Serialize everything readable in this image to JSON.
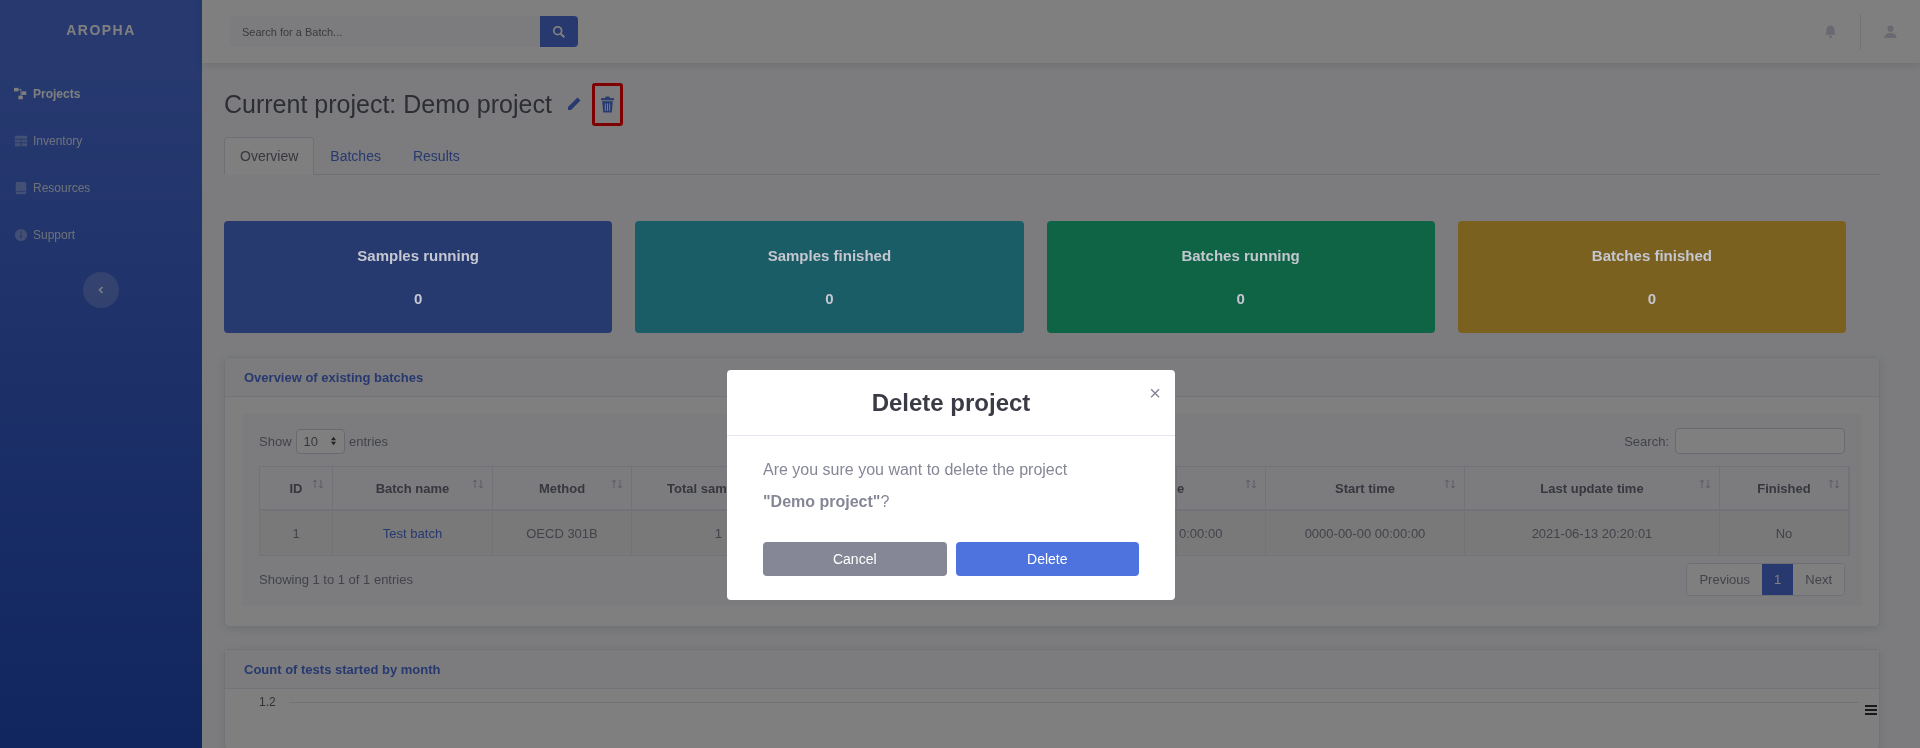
{
  "sidebar": {
    "brand": "AROPHA",
    "items": [
      {
        "label": "Projects",
        "selected": true
      },
      {
        "label": "Inventory",
        "selected": false
      },
      {
        "label": "Resources",
        "selected": false
      },
      {
        "label": "Support",
        "selected": false
      }
    ]
  },
  "topbar": {
    "search": {
      "placeholder": "Search for a Batch..."
    }
  },
  "page": {
    "title": "Current project: Demo project",
    "delete_highlighted": true
  },
  "tabs": [
    {
      "label": "Overview",
      "selected": true
    },
    {
      "label": "Batches",
      "selected": false
    },
    {
      "label": "Results",
      "selected": false
    }
  ],
  "stat_cards": [
    {
      "label": "Samples running",
      "value": "0",
      "color": "#273a70"
    },
    {
      "label": "Samples finished",
      "value": "0",
      "color": "#1b5d66"
    },
    {
      "label": "Batches running",
      "value": "0",
      "color": "#0e6445"
    },
    {
      "label": "Batches finished",
      "value": "0",
      "color": "#7b611f"
    }
  ],
  "batches": {
    "title": "Overview of existing batches",
    "length_label": "Show",
    "length_value": "10",
    "length_suffix": "entries",
    "search_label": "Search:",
    "columns": [
      "ID",
      "Batch name",
      "Method",
      "Total sam",
      "",
      "e",
      "Start time",
      "Last update time",
      "Finished"
    ],
    "rows": [
      [
        "1",
        "Test batch",
        "OECD 301B",
        "1",
        "",
        "0:00:00",
        "0000-00-00 00:00:00",
        "2021-06-13 20:20:01",
        "No"
      ]
    ],
    "info": "Showing 1 to 1 of 1 entries",
    "pages": [
      {
        "label": "Previous",
        "selected": false
      },
      {
        "label": "1",
        "selected": true
      },
      {
        "label": "Next",
        "selected": false
      }
    ]
  },
  "chart": {
    "title": "Count of tests started by month",
    "y_tick": "1.2"
  },
  "modal": {
    "title": "Delete project",
    "close": "×",
    "message": "Are you sure you want to delete the project **\"Demo project\"**?",
    "buttons": [
      {
        "label": "Cancel",
        "kind": "secondary"
      },
      {
        "label": "Delete",
        "kind": "primary"
      }
    ]
  }
}
